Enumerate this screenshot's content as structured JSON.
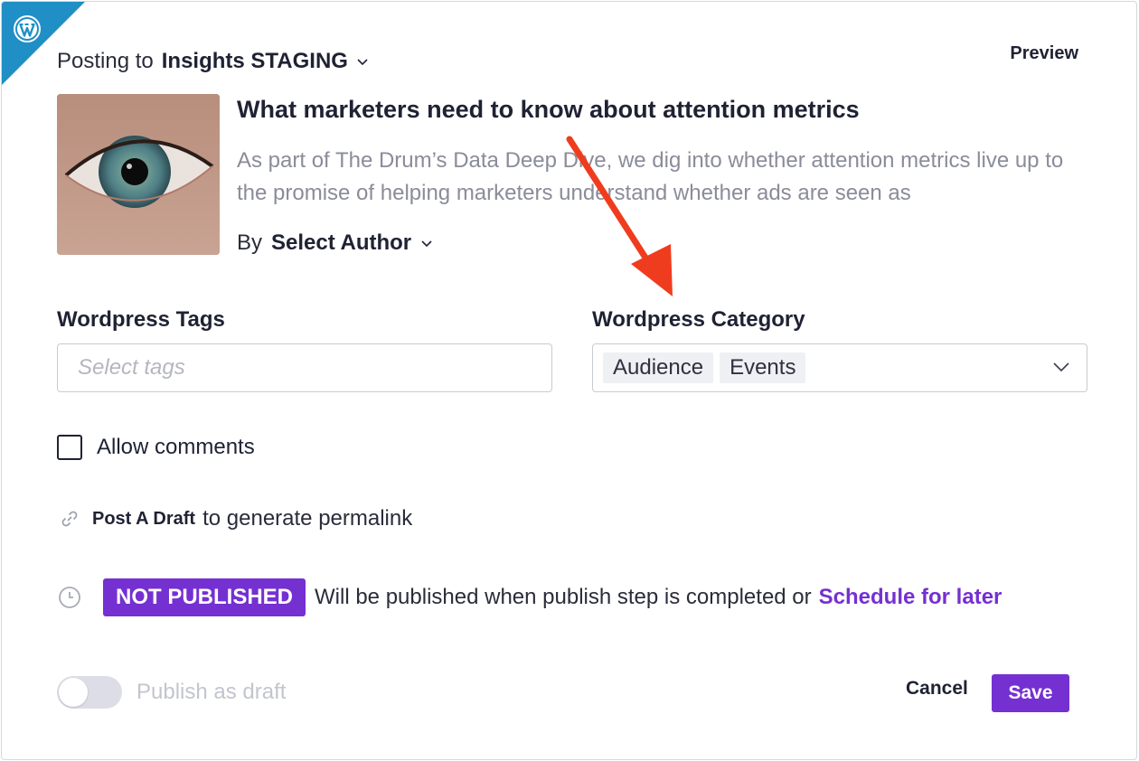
{
  "header": {
    "posting_label": "Posting to",
    "site_name": "Insights STAGING",
    "preview_label": "Preview"
  },
  "article": {
    "title": "What marketers need to know about attention metrics",
    "excerpt": "As part of The Drum’s Data Deep Dive, we dig into whether attention metrics live up to the promise of helping marketers understand whether ads are seen as",
    "author_prefix": "By",
    "author_select": "Select Author"
  },
  "tags": {
    "label": "Wordpress Tags",
    "placeholder": "Select tags"
  },
  "category": {
    "label": "Wordpress Category",
    "selected": [
      "Audience",
      "Events"
    ]
  },
  "comments": {
    "label": "Allow comments",
    "checked": false
  },
  "permalink": {
    "action": "Post A Draft",
    "text": "to generate permalink"
  },
  "status": {
    "badge": "NOT PUBLISHED",
    "text": "Will be published when publish step is completed or",
    "schedule_link": "Schedule for later"
  },
  "footer": {
    "draft_toggle_label": "Publish as draft",
    "draft_toggle_on": false,
    "cancel_label": "Cancel",
    "save_label": "Save"
  },
  "colors": {
    "accent": "#7530d1",
    "wordpress_blue": "#1f8fc6",
    "annotation_arrow": "#f03c1e"
  },
  "icons": [
    "wordpress-icon",
    "chevron-down-icon",
    "link-icon",
    "clock-icon"
  ]
}
